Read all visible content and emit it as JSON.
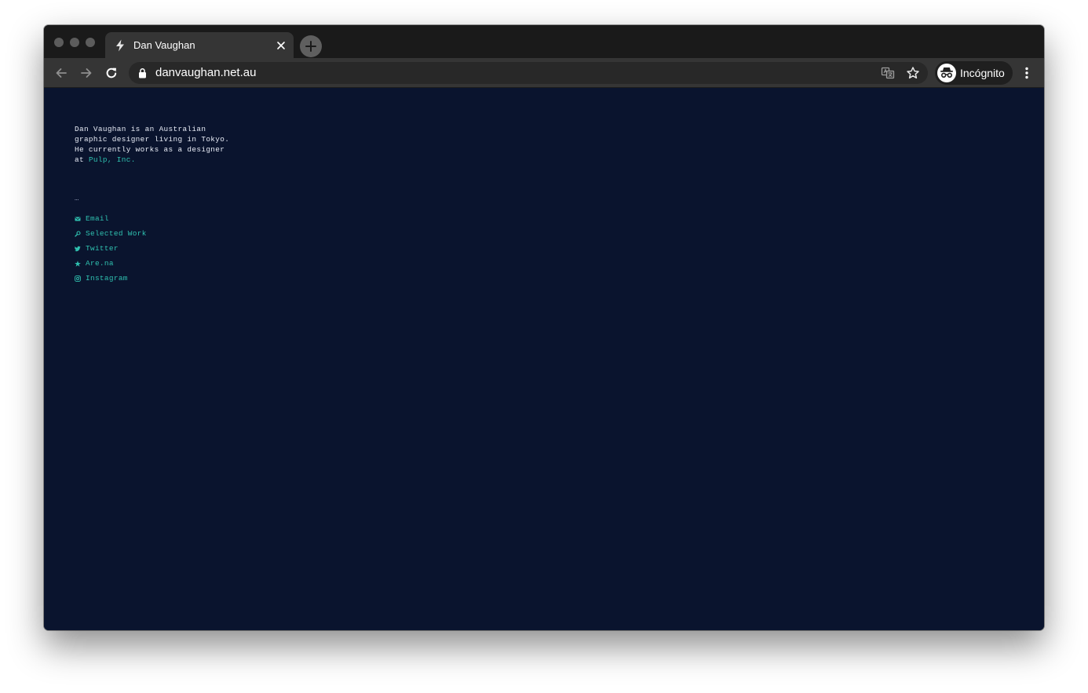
{
  "browser": {
    "tab": {
      "title": "Dan Vaughan"
    },
    "address_bar": {
      "url": "danvaughan.net.au"
    },
    "profile": {
      "label": "Incógnito"
    }
  },
  "page": {
    "bio": {
      "line1": "Dan Vaughan is an Australian",
      "line2": "graphic designer living in Tokyo.",
      "line3": "He currently works as a designer",
      "line4_prefix": "at ",
      "employer_link": "Pulp, Inc."
    },
    "separator": "…",
    "links": [
      {
        "label": "Email",
        "icon": "envelope-icon"
      },
      {
        "label": "Selected Work",
        "icon": "magnifier-icon"
      },
      {
        "label": "Twitter",
        "icon": "twitter-bird-icon"
      },
      {
        "label": "Are.na",
        "icon": "asterisk-icon"
      },
      {
        "label": "Instagram",
        "icon": "instagram-icon"
      }
    ]
  },
  "colors": {
    "page_background": "#0a142e",
    "body_text": "#e7ebf5",
    "accent_link": "#2fc1b0",
    "chrome_toolbar": "#353535",
    "chrome_tabstrip": "#1a1a1a"
  }
}
